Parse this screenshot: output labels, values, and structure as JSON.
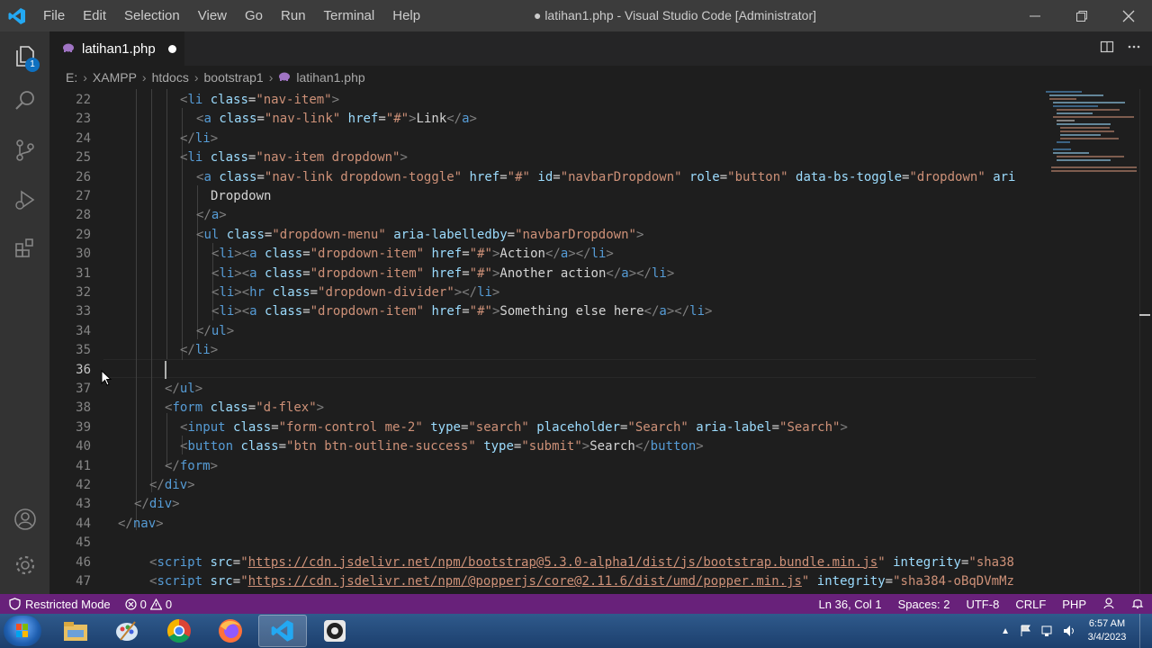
{
  "titlebar": {
    "title": "● latihan1.php - Visual Studio Code [Administrator]",
    "menu": [
      "File",
      "Edit",
      "Selection",
      "View",
      "Go",
      "Run",
      "Terminal",
      "Help"
    ]
  },
  "activity": {
    "explorer_badge": "1"
  },
  "tab": {
    "label": "latihan1.php",
    "icon": "php-elephant-icon",
    "modified": true
  },
  "breadcrumb": [
    "E:",
    "XAMPP",
    "htdocs",
    "bootstrap1",
    "latihan1.php"
  ],
  "editor": {
    "current_line": 36,
    "line_numbers": [
      "22",
      "23",
      "24",
      "25",
      "26",
      "27",
      "28",
      "29",
      "30",
      "31",
      "32",
      "33",
      "34",
      "35",
      "36",
      "37",
      "38",
      "39",
      "40",
      "41",
      "42",
      "43",
      "44",
      "45",
      "46",
      "47"
    ]
  },
  "status": {
    "mode": "Restricted Mode",
    "errors": "0",
    "warnings": "0",
    "position": "Ln 36, Col 1",
    "spaces": "Spaces: 2",
    "encoding": "UTF-8",
    "eol": "CRLF",
    "language": "PHP"
  },
  "taskbar": {
    "time": "6:57 AM",
    "date": "3/4/2023"
  },
  "colors": {
    "statusbar": "#68217a",
    "titlebar": "#3c3c3c",
    "editor_bg": "#1e1e1e",
    "tag": "#569cd6",
    "attribute": "#9cdcfe",
    "string": "#ce9178"
  }
}
